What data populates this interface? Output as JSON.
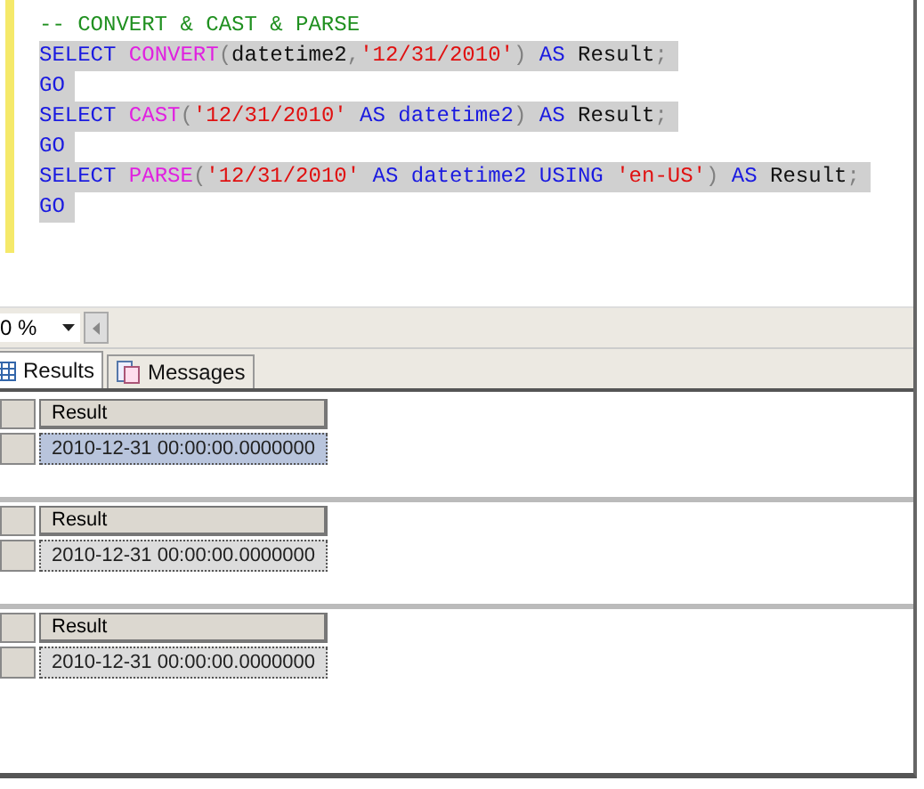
{
  "editor": {
    "lines": [
      {
        "highlighted": false,
        "tokens": [
          {
            "kind": "comment",
            "text": "-- CONVERT & CAST & PARSE"
          }
        ]
      },
      {
        "highlighted": true,
        "tokens": [
          {
            "kind": "keyword",
            "text": "SELECT "
          },
          {
            "kind": "function",
            "text": "CONVERT"
          },
          {
            "kind": "operator",
            "text": "("
          },
          {
            "kind": "plain",
            "text": "datetime2"
          },
          {
            "kind": "operator",
            "text": ","
          },
          {
            "kind": "string",
            "text": "'12/31/2010'"
          },
          {
            "kind": "operator",
            "text": ") "
          },
          {
            "kind": "keyword",
            "text": "AS "
          },
          {
            "kind": "plain",
            "text": "Result"
          },
          {
            "kind": "operator",
            "text": ";"
          }
        ]
      },
      {
        "highlighted": true,
        "tokens": [
          {
            "kind": "keyword",
            "text": "GO"
          }
        ]
      },
      {
        "highlighted": true,
        "tokens": [
          {
            "kind": "keyword",
            "text": "SELECT "
          },
          {
            "kind": "function",
            "text": "CAST"
          },
          {
            "kind": "operator",
            "text": "("
          },
          {
            "kind": "string",
            "text": "'12/31/2010'"
          },
          {
            "kind": "keyword",
            "text": " AS datetime2"
          },
          {
            "kind": "operator",
            "text": ") "
          },
          {
            "kind": "keyword",
            "text": "AS "
          },
          {
            "kind": "plain",
            "text": "Result"
          },
          {
            "kind": "operator",
            "text": ";"
          }
        ]
      },
      {
        "highlighted": true,
        "tokens": [
          {
            "kind": "keyword",
            "text": "GO"
          }
        ]
      },
      {
        "highlighted": true,
        "tokens": [
          {
            "kind": "keyword",
            "text": "SELECT "
          },
          {
            "kind": "function",
            "text": "PARSE"
          },
          {
            "kind": "operator",
            "text": "("
          },
          {
            "kind": "string",
            "text": "'12/31/2010'"
          },
          {
            "kind": "keyword",
            "text": " AS datetime2 USING "
          },
          {
            "kind": "string",
            "text": "'en-US'"
          },
          {
            "kind": "operator",
            "text": ") "
          },
          {
            "kind": "keyword",
            "text": "AS "
          },
          {
            "kind": "plain",
            "text": "Result"
          },
          {
            "kind": "operator",
            "text": ";"
          }
        ]
      },
      {
        "highlighted": true,
        "tokens": [
          {
            "kind": "keyword",
            "text": "GO"
          }
        ]
      }
    ]
  },
  "zoom": {
    "value": "0 %"
  },
  "tabs": [
    {
      "label": "Results",
      "selected": true
    },
    {
      "label": "Messages",
      "selected": false
    }
  ],
  "result_grids": [
    {
      "column": "Result",
      "value": "2010-12-31 00:00:00.0000000",
      "selected": true
    },
    {
      "column": "Result",
      "value": "2010-12-31 00:00:00.0000000",
      "selected": false
    },
    {
      "column": "Result",
      "value": "2010-12-31 00:00:00.0000000",
      "selected": false
    }
  ]
}
